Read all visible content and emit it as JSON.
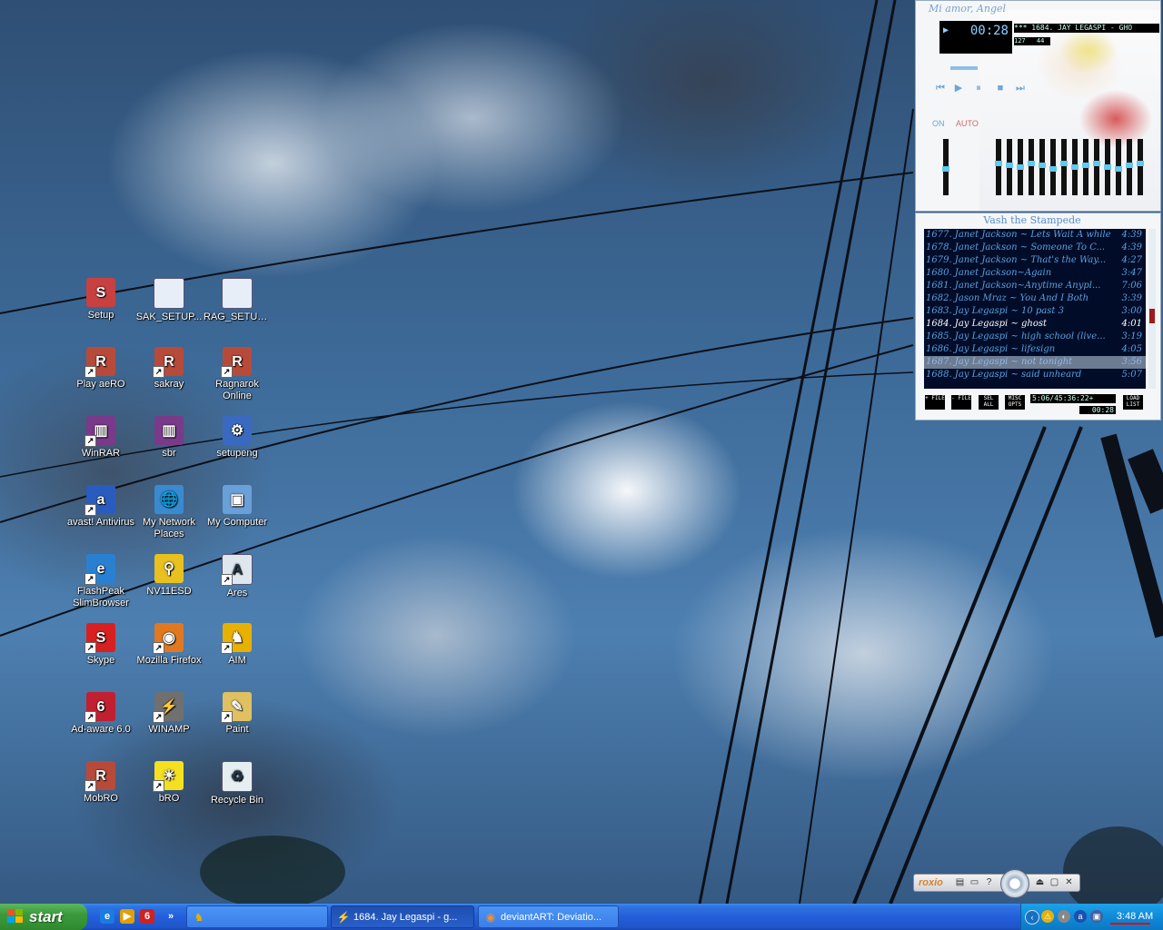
{
  "desktop_icons": [
    {
      "label": "Setup",
      "icon": "setup-icon",
      "shortcut": false
    },
    {
      "label": "SAK_SETUP...",
      "icon": "window-icon",
      "shortcut": false
    },
    {
      "label": "RAG_SETUP...",
      "icon": "window-icon",
      "shortcut": false
    },
    {
      "label": "Play aeRO",
      "icon": "game-icon",
      "shortcut": true
    },
    {
      "label": "sakray",
      "icon": "game-icon",
      "shortcut": true
    },
    {
      "label": "Ragnarok Online",
      "icon": "game-icon",
      "shortcut": true
    },
    {
      "label": "WinRAR",
      "icon": "winrar-icon",
      "shortcut": true
    },
    {
      "label": "sbr",
      "icon": "winrar-icon",
      "shortcut": false
    },
    {
      "label": "setupeng",
      "icon": "installer-icon",
      "shortcut": false
    },
    {
      "label": "avast! Antivirus",
      "icon": "avast-icon",
      "shortcut": true
    },
    {
      "label": "My Network Places",
      "icon": "network-icon",
      "shortcut": false
    },
    {
      "label": "My Computer",
      "icon": "computer-icon",
      "shortcut": false
    },
    {
      "label": "FlashPeak SlimBrowser",
      "icon": "browser-icon",
      "shortcut": true
    },
    {
      "label": "NV11ESD",
      "icon": "nvidia-icon",
      "shortcut": false
    },
    {
      "label": "Ares",
      "icon": "ares-icon",
      "shortcut": true
    },
    {
      "label": "Skype",
      "icon": "skype-icon",
      "shortcut": true
    },
    {
      "label": "Mozilla Firefox",
      "icon": "firefox-icon",
      "shortcut": true
    },
    {
      "label": "AIM",
      "icon": "aim-icon",
      "shortcut": true
    },
    {
      "label": "Ad-aware 6.0",
      "icon": "adaware-icon",
      "shortcut": true
    },
    {
      "label": "WINAMP",
      "icon": "winamp-icon",
      "shortcut": true
    },
    {
      "label": "Paint",
      "icon": "paint-icon",
      "shortcut": true
    },
    {
      "label": "MobRO",
      "icon": "game-icon",
      "shortcut": true
    },
    {
      "label": "bRO",
      "icon": "sun-icon",
      "shortcut": true
    },
    {
      "label": "Recycle Bin",
      "icon": "recycle-bin-icon",
      "shortcut": false
    }
  ],
  "winamp": {
    "title": "Mi amor, Angel",
    "time": "00:28",
    "marquee": "***  1684. JAY LEGASPI - GHO",
    "kbps": "127",
    "khz": "44",
    "eq_on": "ON",
    "eq_auto": "AUTO"
  },
  "playlist": {
    "title": "Vash the Stampede",
    "rows": [
      {
        "title": "1677. Janet Jackson ~ Lets Wait A while",
        "duration": "4:39",
        "state": ""
      },
      {
        "title": "1678. Janet Jackson ~ Someone To C...",
        "duration": "4:39",
        "state": ""
      },
      {
        "title": "1679. Janet Jackson ~ That's the Way...",
        "duration": "4:27",
        "state": ""
      },
      {
        "title": "1680. Janet Jackson~Again",
        "duration": "3:47",
        "state": ""
      },
      {
        "title": "1681. Janet Jackson~Anytime Anypl...",
        "duration": "7:06",
        "state": ""
      },
      {
        "title": "1682. Jason Mraz ~ You And I Both",
        "duration": "3:39",
        "state": ""
      },
      {
        "title": "1683. Jay Legaspi ~ 10 past 3",
        "duration": "3:00",
        "state": ""
      },
      {
        "title": "1684. Jay Legaspi ~ ghost",
        "duration": "4:01",
        "state": "current"
      },
      {
        "title": "1685. Jay Legaspi ~ high school (live...",
        "duration": "3:19",
        "state": ""
      },
      {
        "title": "1686. Jay Legaspi ~ lifesign",
        "duration": "4:05",
        "state": ""
      },
      {
        "title": "1687. Jay Legaspi ~ not tonight",
        "duration": "3:56",
        "state": "selected"
      },
      {
        "title": "1688. Jay Legaspi ~ said unheard",
        "duration": "5:07",
        "state": ""
      }
    ],
    "buttons": [
      "+ FILE",
      "- FILE",
      "SEL ALL",
      "MISC OPTS",
      "LOAD LIST"
    ],
    "info": "5:06/45:36:22+",
    "current_time": "00:28"
  },
  "roxio": {
    "logo": "roxio"
  },
  "taskbar": {
    "start_label": "start",
    "quick_launch": [
      "ie-icon",
      "media-player-icon",
      "adaware-icon"
    ],
    "overflow": "»",
    "tasks": [
      {
        "label": "",
        "icon": "aim-icon",
        "active": false
      },
      {
        "label": "1684. Jay Legaspi - g...",
        "icon": "winamp-icon",
        "active": true
      },
      {
        "label": "deviantART: Deviatio...",
        "icon": "firefox-icon",
        "active": false
      }
    ],
    "clock": "3:48 AM"
  },
  "colors": {
    "taskbar_blue": "#245edb",
    "start_green": "#3c9a3c",
    "tray_blue": "#0f8ad8",
    "playlist_bg": "#000c28",
    "playlist_text": "#5aa0e0"
  }
}
